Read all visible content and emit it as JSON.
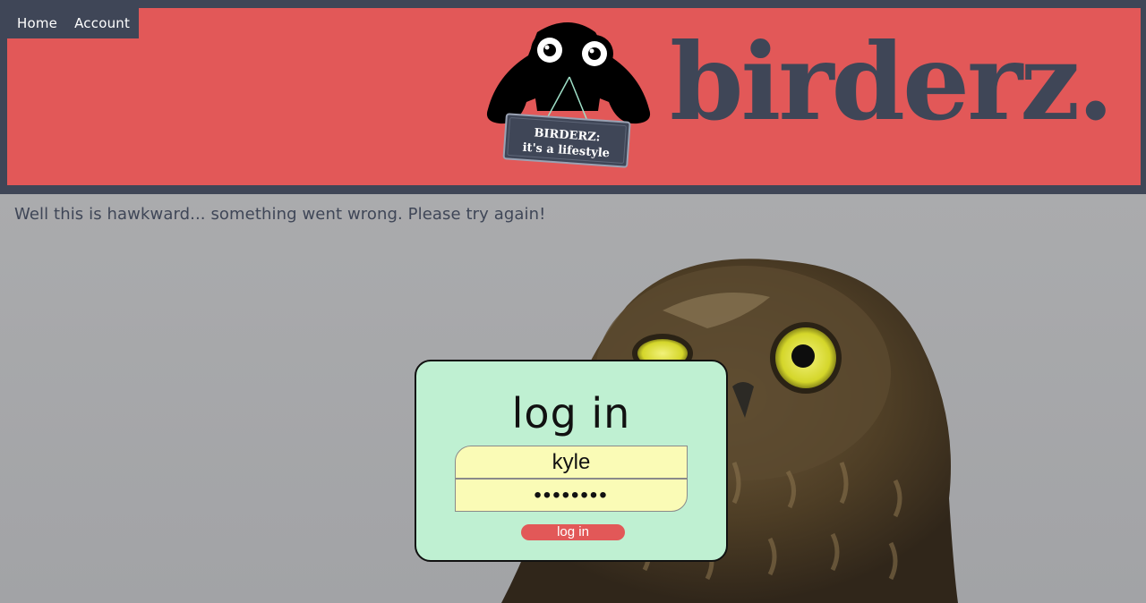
{
  "nav": {
    "items": [
      {
        "label": "Home"
      },
      {
        "label": "Account"
      }
    ]
  },
  "brand": {
    "name": "birderz.",
    "sign_line1": "BIRDERZ:",
    "sign_line2": "it's a lifestyle"
  },
  "error": {
    "message": "Well this is hawkward... something went wrong. Please try again!"
  },
  "login": {
    "title": "log in",
    "username_value": "kyle",
    "password_display": "••••••••",
    "submit_label": "log in"
  },
  "colors": {
    "banner": "#e25858",
    "frame": "#3f4657",
    "card": "#bff0d2",
    "field": "#fafbb6"
  }
}
